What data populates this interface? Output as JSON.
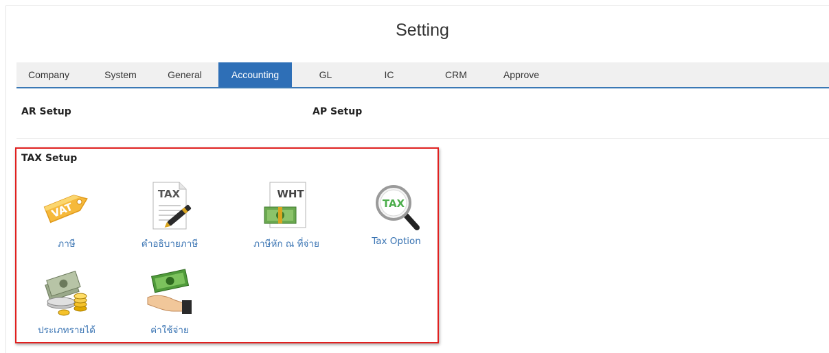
{
  "page": {
    "title": "Setting"
  },
  "tabs": [
    {
      "label": "Company",
      "active": false
    },
    {
      "label": "System",
      "active": false
    },
    {
      "label": "General",
      "active": false
    },
    {
      "label": "Accounting",
      "active": true
    },
    {
      "label": "GL",
      "active": false
    },
    {
      "label": "IC",
      "active": false
    },
    {
      "label": "CRM",
      "active": false
    },
    {
      "label": "Approve",
      "active": false
    }
  ],
  "sections": {
    "ar_setup": "AR Setup",
    "ap_setup": "AP Setup",
    "tax_setup": "TAX Setup"
  },
  "tax_items": [
    {
      "label": "ภาษี",
      "icon": "vat-tag-icon",
      "icon_text": "VAT"
    },
    {
      "label": "คำอธิบายภาษี",
      "icon": "tax-document-pen-icon",
      "icon_text": "TAX"
    },
    {
      "label": "ภาษีหัก ณ ที่จ่าย",
      "icon": "wht-money-document-icon",
      "icon_text": "WHT"
    },
    {
      "label": "Tax Option",
      "icon": "tax-magnifier-icon",
      "icon_text": "TAX"
    },
    {
      "label": "ประเภทรายได้",
      "icon": "cash-coins-icon"
    },
    {
      "label": "ค่าใช้จ่าย",
      "icon": "hand-money-icon"
    }
  ],
  "colors": {
    "accent": "#2e6fb7",
    "link": "#3a74b3",
    "highlight_border": "#e0201f"
  }
}
